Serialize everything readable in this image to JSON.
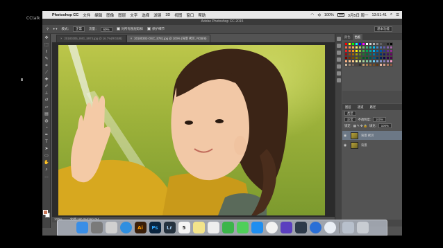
{
  "overlay": {
    "corner_label": "CCtalk"
  },
  "menubar": {
    "app_name": "Photoshop CC",
    "items": [
      "文件",
      "编辑",
      "图像",
      "图层",
      "文字",
      "选择",
      "滤镜",
      "3D",
      "视图",
      "窗口",
      "帮助"
    ],
    "battery": "100%",
    "date": "3月5日 周一",
    "time": "13:51:41"
  },
  "window_title": "Adobe Photoshop CC 2015",
  "options_bar": {
    "mode_label": "模式：",
    "mode_value": "正常",
    "opacity_label": "流量：",
    "opacity_value": "60%",
    "sample_all_layers": "对所有图层取样",
    "protect_detail": "保护细节",
    "workspace": "基本功能"
  },
  "document_tabs": [
    {
      "name": "20180305_IMG_5974.jpg @ 16.7%(RGB/8)",
      "active": false
    },
    {
      "name": "20180302-OSC_5781.jpg @ 100% (背景 拷贝, RGB/8)",
      "active": true
    }
  ],
  "status_bar": {
    "zoom": "100%",
    "doc_size": "文档:180.0M/360.0M"
  },
  "panels": {
    "color_tabs": [
      "颜色",
      "色板"
    ],
    "layers_tabs": [
      "图层",
      "通道",
      "路径"
    ],
    "kind_label": "类型",
    "blend_mode": "正常",
    "opacity_label": "不透明度:",
    "opacity_value": "100%",
    "lock_label": "锁定:",
    "fill_label": "填充:",
    "fill_value": "100%",
    "layers": [
      {
        "name": "背景 拷贝",
        "selected": true
      },
      {
        "name": "背景",
        "selected": false
      }
    ]
  },
  "dock": {
    "apps": [
      {
        "icon": "finder-icon",
        "label": "",
        "color": "#3a8ee6"
      },
      {
        "icon": "system-preferences-icon",
        "label": "",
        "color": "#7a7a7a"
      },
      {
        "icon": "launchpad-icon",
        "label": "",
        "color": "#d0d0d0"
      },
      {
        "icon": "safari-icon",
        "label": "",
        "color": "#2f8fe0"
      },
      {
        "icon": "illustrator-icon",
        "label": "Ai",
        "color": "#3a1f0a"
      },
      {
        "icon": "photoshop-icon",
        "label": "Ps",
        "color": "#0a2540"
      },
      {
        "icon": "lightroom-icon",
        "label": "Lr",
        "color": "#25323f"
      },
      {
        "icon": "calendar-icon",
        "label": "5",
        "color": "#f4f4f4"
      },
      {
        "icon": "notes-icon",
        "label": "",
        "color": "#f3e48a"
      },
      {
        "icon": "reminders-icon",
        "label": "",
        "color": "#eeeeee"
      },
      {
        "icon": "facetime-icon",
        "label": "",
        "color": "#3cb54a"
      },
      {
        "icon": "messages-icon",
        "label": "",
        "color": "#4fcf5a"
      },
      {
        "icon": "app-store-icon",
        "label": "",
        "color": "#1f8ef0"
      },
      {
        "icon": "photos-icon",
        "label": "",
        "color": "#f2f2f2"
      },
      {
        "icon": "imovie-icon",
        "label": "",
        "color": "#5b3fbf"
      },
      {
        "icon": "quicktime-icon",
        "label": "",
        "color": "#2d3a4a"
      },
      {
        "icon": "baidu-netdisk-icon",
        "label": "",
        "color": "#2a6fd6"
      },
      {
        "icon": "qq-icon",
        "label": "",
        "color": "#e9eef5"
      },
      {
        "icon": "downloads-icon",
        "label": "",
        "color": "#b8c0cc"
      },
      {
        "icon": "trash-icon",
        "label": "",
        "color": "#c8ccd2"
      }
    ]
  },
  "colors": {
    "accent": "#c9785a",
    "swatches": [
      "#ff0000",
      "#ffff00",
      "#00ff00",
      "#00ffff",
      "#0000ff",
      "#ff00ff",
      "#ffffff",
      "#d8d8d8",
      "#b0b0b0",
      "#888888",
      "#606060",
      "#404040",
      "#202020",
      "#000000",
      "#f26c4f",
      "#f68e55",
      "#fbaf5c",
      "#fff467",
      "#acd372",
      "#7cc576",
      "#3bb878",
      "#1abbb4",
      "#00bff3",
      "#438ccb",
      "#5574b9",
      "#605ca8",
      "#855fa8",
      "#a763a8",
      "#ed1c24",
      "#f26522",
      "#f7941d",
      "#fff200",
      "#8dc63f",
      "#39b54a",
      "#00a651",
      "#00a99d",
      "#00aeef",
      "#0072bc",
      "#0054a6",
      "#2e3192",
      "#662d91",
      "#92278f",
      "#9e0b0f",
      "#a0410d",
      "#a36209",
      "#aba000",
      "#598527",
      "#1a7b30",
      "#007236",
      "#00746b",
      "#0076a3",
      "#004b80",
      "#003471",
      "#1b1464",
      "#440e62",
      "#630460",
      "#790000",
      "#7b2e00",
      "#7d4900",
      "#827b00",
      "#406618",
      "#005e20",
      "#005826",
      "#005952",
      "#005b7f",
      "#003663",
      "#002157",
      "#0d004c",
      "#32004b",
      "#4b0049",
      "#f9ad81",
      "#fbc595",
      "#fdc689",
      "#fff799",
      "#c4df9b",
      "#a3d39c",
      "#82ca9c",
      "#7accc8",
      "#6dcff6",
      "#7da7d9",
      "#8393ca",
      "#8781bd",
      "#a186be",
      "#f49ac2",
      "#c7b299",
      "#998675",
      "#736357",
      "#534741",
      "#37302d",
      "#c69c6d",
      "#a67c52",
      "#8c6239",
      "#754c24",
      "#603913",
      "#e6b8a2",
      "#d8a08a",
      "#b07a62",
      "#8a5a44"
    ]
  }
}
